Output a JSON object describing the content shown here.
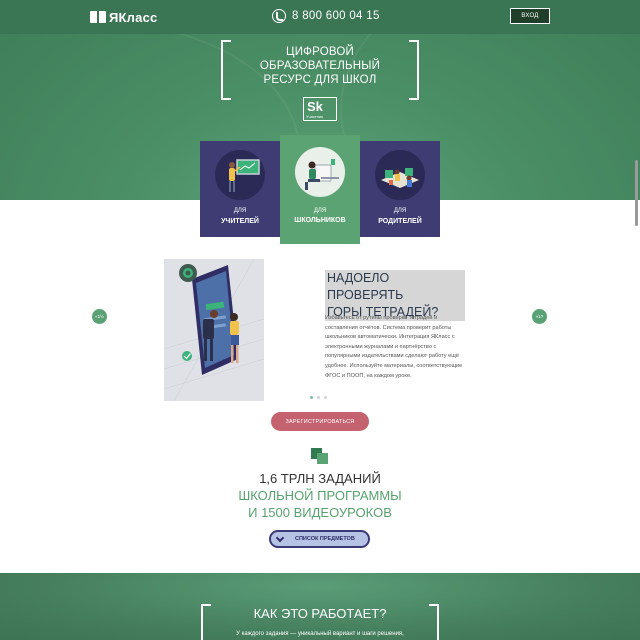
{
  "header": {
    "logo_text": "ЯКласс",
    "phone": "8 800 600 04 15",
    "login_label": "ВХОД"
  },
  "hero": {
    "title_lines": [
      "ЦИФРОВОЙ",
      "ОБРАЗОВАТЕЛЬНЫЙ",
      "РЕСУРС ДЛЯ ШКОЛ"
    ],
    "sk_badge": {
      "big": "Sk",
      "small": "Участник"
    }
  },
  "audience": {
    "cards": [
      {
        "line1": "ДЛЯ",
        "line2": "УЧИТЕЛЕЙ",
        "active": false
      },
      {
        "line1": "ДЛЯ",
        "line2": "ШКОЛЬНИКОВ",
        "active": true
      },
      {
        "line1": "ДЛЯ",
        "line2": "РОДИТЕЛЕЙ",
        "active": false
      }
    ]
  },
  "slide": {
    "title_line1": "НАДОЕЛО ПРОВЕРЯТЬ",
    "title_line2": "ГОРЫ ТЕТРАДЕЙ?",
    "text_lines": [
      "Избавьтесь от рутины проверки тетрадей и",
      "составления отчётов. Система проверит работы",
      "школьников автоматически. Интеграция ЯКласс с",
      "электронными журналами и партнёрство с",
      "популярными издательствами сделают работу ещё",
      "удобнее. Используйте материалы, соответствующие",
      "ФГОС и ПООП, на каждом уроке."
    ],
    "prev_label": "«1½",
    "next_label": "«1?",
    "pager": {
      "count": 3,
      "active_index": 0
    },
    "register_label": "ЗАРЕГИСТРИРОВАТЬСЯ"
  },
  "stats": {
    "line1": "1,6 ТРЛН ЗАДАНИЙ",
    "line2": "ШКОЛЬНОЙ ПРОГРАММЫ",
    "line3": "И 1500 ВИДЕОУРОКОВ",
    "subjects_label": "СПИСОК ПРЕДМЕТОВ"
  },
  "how": {
    "title": "КАК ЭТО РАБОТАЕТ?",
    "subtitle": "У каждого задания — уникальный вариант и шаги решения,"
  },
  "colors": {
    "header_green": "#3a7653",
    "card_purple": "#3e3c73",
    "card_active_green": "#5ba372",
    "register_red": "#c4636f",
    "stats_green": "#56a26e"
  }
}
